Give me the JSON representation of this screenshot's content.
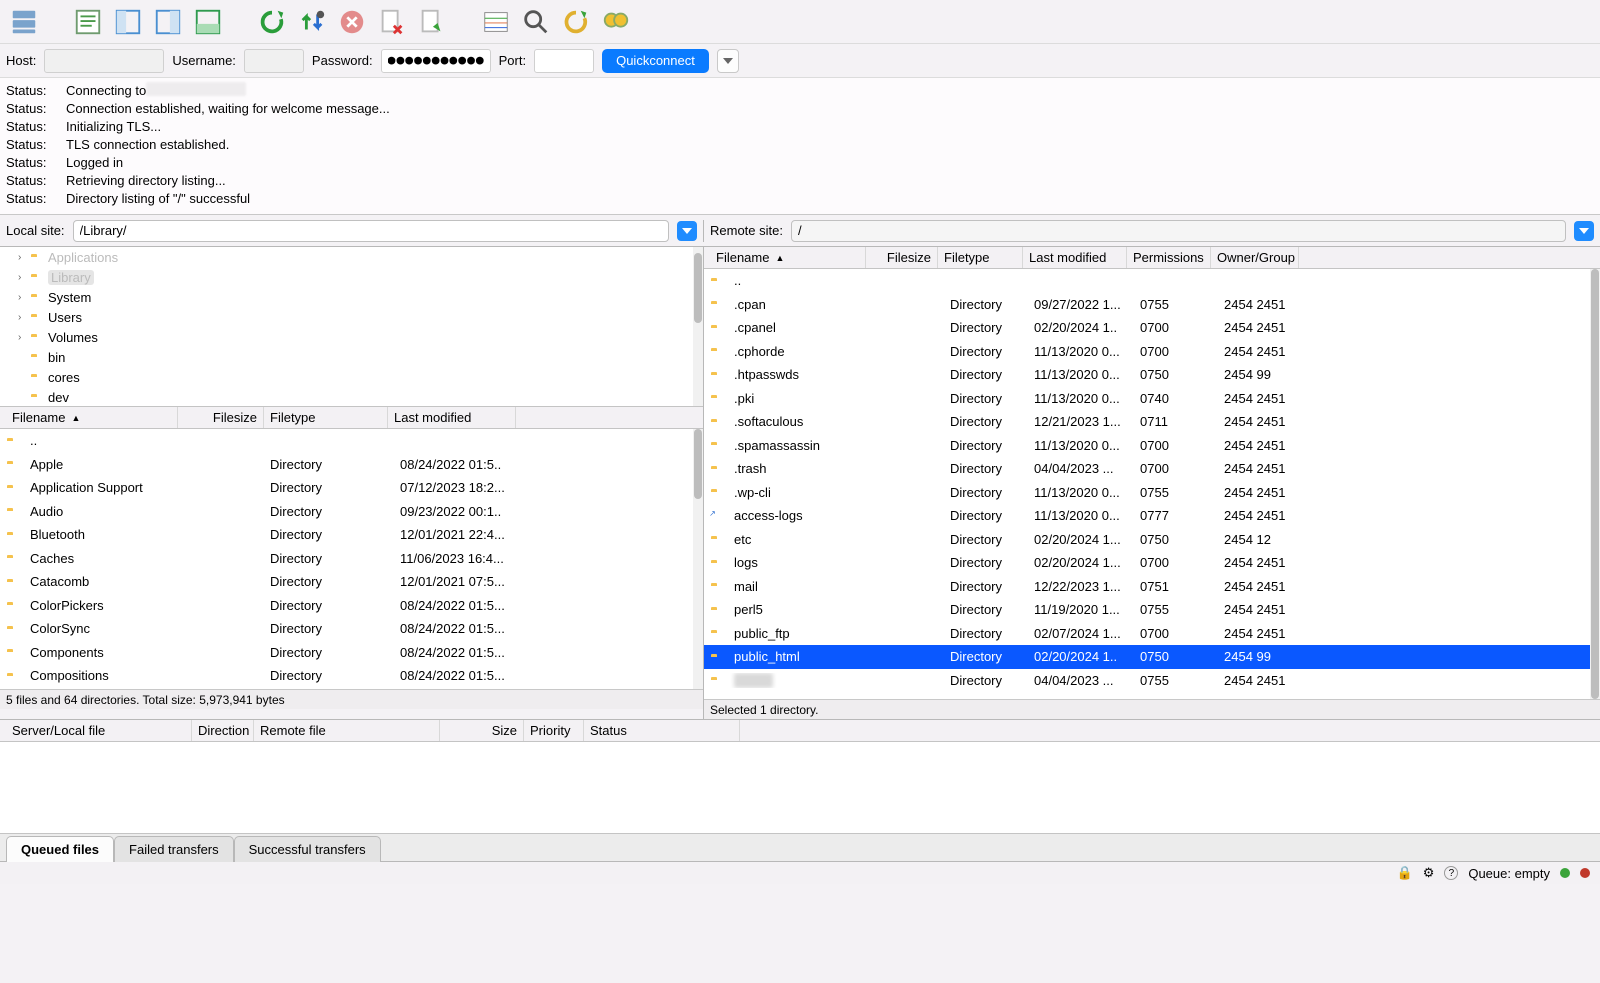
{
  "conn": {
    "host_label": "Host:",
    "username_label": "Username:",
    "password_label": "Password:",
    "password_mask": "●●●●●●●●●●●●●●",
    "port_label": "Port:",
    "quickconnect": "Quickconnect"
  },
  "log": [
    {
      "label": "Status:",
      "msg": "Connecting to",
      "blur": true
    },
    {
      "label": "Status:",
      "msg": "Connection established, waiting for welcome message..."
    },
    {
      "label": "Status:",
      "msg": "Initializing TLS..."
    },
    {
      "label": "Status:",
      "msg": "TLS connection established."
    },
    {
      "label": "Status:",
      "msg": "Logged in"
    },
    {
      "label": "Status:",
      "msg": "Retrieving directory listing..."
    },
    {
      "label": "Status:",
      "msg": "Directory listing of \"/\" successful"
    }
  ],
  "local": {
    "label": "Local site:",
    "path": "/Library/",
    "tree": [
      {
        "name": "Applications",
        "expand": true,
        "sel": false,
        "dim": true
      },
      {
        "name": "Library",
        "expand": true,
        "sel": true
      },
      {
        "name": "System",
        "expand": true
      },
      {
        "name": "Users",
        "expand": true
      },
      {
        "name": "Volumes",
        "expand": true
      },
      {
        "name": "bin"
      },
      {
        "name": "cores"
      },
      {
        "name": "dev"
      }
    ],
    "cols": {
      "filename": "Filename",
      "filesize": "Filesize",
      "filetype": "Filetype",
      "modified": "Last modified"
    },
    "files": [
      {
        "name": "..",
        "type": "",
        "date": ""
      },
      {
        "name": "Apple",
        "type": "Directory",
        "date": "08/24/2022 01:5.."
      },
      {
        "name": "Application Support",
        "type": "Directory",
        "date": "07/12/2023 18:2..."
      },
      {
        "name": "Audio",
        "type": "Directory",
        "date": "09/23/2022 00:1.."
      },
      {
        "name": "Bluetooth",
        "type": "Directory",
        "date": "12/01/2021 22:4..."
      },
      {
        "name": "Caches",
        "type": "Directory",
        "date": "11/06/2023 16:4..."
      },
      {
        "name": "Catacomb",
        "type": "Directory",
        "date": "12/01/2021 07:5..."
      },
      {
        "name": "ColorPickers",
        "type": "Directory",
        "date": "08/24/2022 01:5..."
      },
      {
        "name": "ColorSync",
        "type": "Directory",
        "date": "08/24/2022 01:5..."
      },
      {
        "name": "Components",
        "type": "Directory",
        "date": "08/24/2022 01:5..."
      },
      {
        "name": "Compositions",
        "type": "Directory",
        "date": "08/24/2022 01:5..."
      }
    ],
    "status": "5 files and 64 directories. Total size: 5,973,941 bytes"
  },
  "remote": {
    "label": "Remote site:",
    "path": "/",
    "cols": {
      "filename": "Filename",
      "filesize": "Filesize",
      "filetype": "Filetype",
      "modified": "Last modified",
      "perm": "Permissions",
      "owner": "Owner/Group"
    },
    "files": [
      {
        "name": "..",
        "type": "",
        "date": "",
        "perm": "",
        "owner": ""
      },
      {
        "name": ".cpan",
        "type": "Directory",
        "date": "09/27/2022 1...",
        "perm": "0755",
        "owner": "2454 2451"
      },
      {
        "name": ".cpanel",
        "type": "Directory",
        "date": "02/20/2024 1..",
        "perm": "0700",
        "owner": "2454 2451"
      },
      {
        "name": ".cphorde",
        "type": "Directory",
        "date": "11/13/2020 0...",
        "perm": "0700",
        "owner": "2454 2451"
      },
      {
        "name": ".htpasswds",
        "type": "Directory",
        "date": "11/13/2020 0...",
        "perm": "0750",
        "owner": "2454 99"
      },
      {
        "name": ".pki",
        "type": "Directory",
        "date": "11/13/2020 0...",
        "perm": "0740",
        "owner": "2454 2451"
      },
      {
        "name": ".softaculous",
        "type": "Directory",
        "date": "12/21/2023 1...",
        "perm": "0711",
        "owner": "2454 2451"
      },
      {
        "name": ".spamassassin",
        "type": "Directory",
        "date": "11/13/2020 0...",
        "perm": "0700",
        "owner": "2454 2451"
      },
      {
        "name": ".trash",
        "type": "Directory",
        "date": "04/04/2023 ...",
        "perm": "0700",
        "owner": "2454 2451"
      },
      {
        "name": ".wp-cli",
        "type": "Directory",
        "date": "11/13/2020 0...",
        "perm": "0755",
        "owner": "2454 2451"
      },
      {
        "name": "access-logs",
        "type": "Directory",
        "date": "11/13/2020 0...",
        "perm": "0777",
        "owner": "2454 2451",
        "link": true
      },
      {
        "name": "etc",
        "type": "Directory",
        "date": "02/20/2024 1...",
        "perm": "0750",
        "owner": "2454 12"
      },
      {
        "name": "logs",
        "type": "Directory",
        "date": "02/20/2024 1...",
        "perm": "0700",
        "owner": "2454 2451"
      },
      {
        "name": "mail",
        "type": "Directory",
        "date": "12/22/2023 1...",
        "perm": "0751",
        "owner": "2454 2451"
      },
      {
        "name": "perl5",
        "type": "Directory",
        "date": "11/19/2020 1...",
        "perm": "0755",
        "owner": "2454 2451"
      },
      {
        "name": "public_ftp",
        "type": "Directory",
        "date": "02/07/2024 1...",
        "perm": "0700",
        "owner": "2454 2451"
      },
      {
        "name": "public_html",
        "type": "Directory",
        "date": "02/20/2024 1..",
        "perm": "0750",
        "owner": "2454 99",
        "sel": true
      },
      {
        "name": "hidden",
        "type": "Directory",
        "date": "04/04/2023 ...",
        "perm": "0755",
        "owner": "2454 2451",
        "blur": true
      }
    ],
    "status": "Selected 1 directory."
  },
  "xfer_cols": {
    "server": "Server/Local file",
    "dir": "Direction",
    "remote": "Remote file",
    "size": "Size",
    "prio": "Priority",
    "status": "Status"
  },
  "tabs": {
    "queued": "Queued files",
    "failed": "Failed transfers",
    "success": "Successful transfers"
  },
  "footer": {
    "queue": "Queue: empty"
  }
}
